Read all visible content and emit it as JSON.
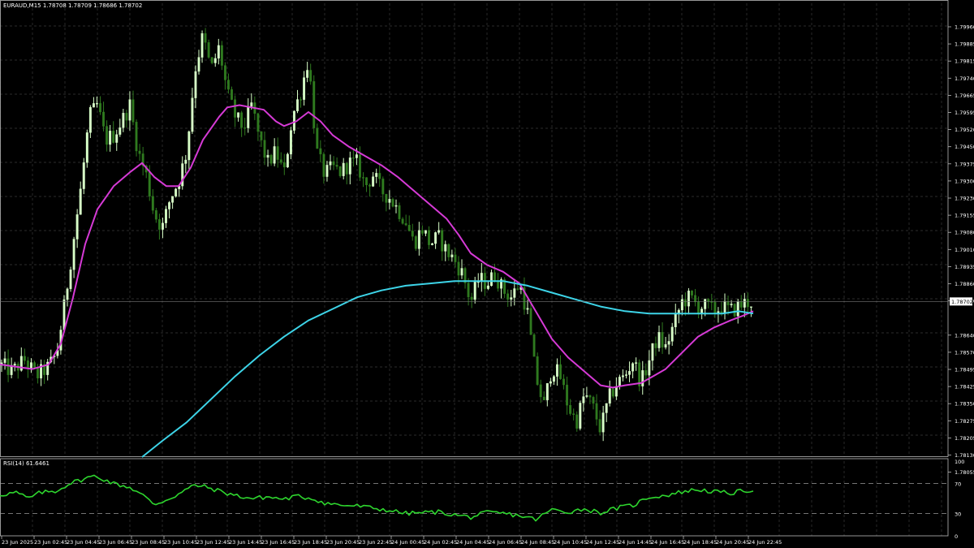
{
  "header": {
    "symbol_info": "EURAUD,M15  1.78708 1.78709 1.78686 1.78702"
  },
  "colors": {
    "background": "#000000",
    "grid": "#3a3a3a",
    "candle_bull": "#d8ffc8",
    "candle_bear": "#2f7a1f",
    "ma_fast": "#d63ad6",
    "ma_slow": "#3dd4e8",
    "rsi_line": "#2ed62e",
    "price_tag_bg": "#ffffff",
    "price_tag_text": "#000000"
  },
  "chart_data": [
    {
      "type": "candlestick",
      "title": "EURAUD,M15",
      "price_axis_ticks": [
        "1.79960",
        "1.79885",
        "1.79815",
        "1.79740",
        "1.79665",
        "1.79595",
        "1.79520",
        "1.79450",
        "1.79375",
        "1.79300",
        "1.79230",
        "1.79155",
        "1.79080",
        "1.79010",
        "1.78935",
        "1.78860",
        "1.78790",
        "1.78640",
        "1.78570",
        "1.78495",
        "1.78425",
        "1.78350",
        "1.78275",
        "1.78205",
        "1.78130",
        "1.78055"
      ],
      "ylim": [
        1.7803,
        1.7999
      ],
      "current_price": "1.78702",
      "last_ohlc": {
        "open": 1.78708,
        "high": 1.78709,
        "low": 1.78686,
        "close": 1.78702
      },
      "grid": true,
      "series": [
        {
          "kind": "moving_average",
          "color": "#d63ad6",
          "points": [
            [
              0,
              1.7843
            ],
            [
              20,
              1.7842
            ],
            [
              40,
              1.7841
            ],
            [
              60,
              1.7843
            ],
            [
              75,
              1.7852
            ],
            [
              90,
              1.7872
            ],
            [
              105,
              1.7895
            ],
            [
              120,
              1.791
            ],
            [
              140,
              1.792
            ],
            [
              160,
              1.7926
            ],
            [
              175,
              1.793
            ],
            [
              190,
              1.7924
            ],
            [
              205,
              1.792
            ],
            [
              220,
              1.792
            ],
            [
              235,
              1.7928
            ],
            [
              250,
              1.794
            ],
            [
              270,
              1.795
            ],
            [
              280,
              1.7954
            ],
            [
              295,
              1.7955
            ],
            [
              310,
              1.7954
            ],
            [
              325,
              1.7953
            ],
            [
              340,
              1.7948
            ],
            [
              350,
              1.7946
            ],
            [
              365,
              1.7948
            ],
            [
              380,
              1.7952
            ],
            [
              395,
              1.7948
            ],
            [
              410,
              1.7942
            ],
            [
              430,
              1.7937
            ],
            [
              450,
              1.7933
            ],
            [
              470,
              1.7929
            ],
            [
              490,
              1.7924
            ],
            [
              510,
              1.7918
            ],
            [
              530,
              1.7912
            ],
            [
              550,
              1.7906
            ],
            [
              565,
              1.7899
            ],
            [
              580,
              1.7891
            ],
            [
              600,
              1.7886
            ],
            [
              620,
              1.7883
            ],
            [
              640,
              1.7878
            ],
            [
              660,
              1.7866
            ],
            [
              680,
              1.7854
            ],
            [
              700,
              1.7846
            ],
            [
              720,
              1.784
            ],
            [
              740,
              1.7834
            ],
            [
              755,
              1.7833
            ],
            [
              770,
              1.7834
            ],
            [
              790,
              1.7835
            ],
            [
              805,
              1.7838
            ],
            [
              820,
              1.7841
            ],
            [
              840,
              1.7848
            ],
            [
              860,
              1.7855
            ],
            [
              880,
              1.7859
            ],
            [
              900,
              1.7862
            ],
            [
              915,
              1.7864
            ],
            [
              928,
              1.7866
            ]
          ]
        },
        {
          "kind": "moving_average",
          "color": "#3dd4e8",
          "points": [
            [
              175,
              1.7803
            ],
            [
              200,
              1.781
            ],
            [
              230,
              1.7818
            ],
            [
              260,
              1.7828
            ],
            [
              290,
              1.7838
            ],
            [
              320,
              1.7847
            ],
            [
              350,
              1.7855
            ],
            [
              380,
              1.7862
            ],
            [
              410,
              1.7867
            ],
            [
              440,
              1.7872
            ],
            [
              470,
              1.7875
            ],
            [
              500,
              1.7877
            ],
            [
              530,
              1.7878
            ],
            [
              560,
              1.7879
            ],
            [
              590,
              1.7879
            ],
            [
              620,
              1.7879
            ],
            [
              650,
              1.7877
            ],
            [
              680,
              1.7874
            ],
            [
              710,
              1.7871
            ],
            [
              740,
              1.7868
            ],
            [
              770,
              1.7866
            ],
            [
              800,
              1.7865
            ],
            [
              830,
              1.7865
            ],
            [
              860,
              1.7865
            ],
            [
              890,
              1.7865
            ],
            [
              910,
              1.7866
            ],
            [
              928,
              1.7865
            ]
          ]
        }
      ],
      "price_anchors": [
        [
          0,
          1.7843
        ],
        [
          15,
          1.784
        ],
        [
          30,
          1.7845
        ],
        [
          45,
          1.7838
        ],
        [
          60,
          1.7842
        ],
        [
          70,
          1.7848
        ],
        [
          80,
          1.787
        ],
        [
          90,
          1.7895
        ],
        [
          100,
          1.792
        ],
        [
          110,
          1.795
        ],
        [
          120,
          1.7955
        ],
        [
          130,
          1.794
        ],
        [
          140,
          1.7942
        ],
        [
          150,
          1.7948
        ],
        [
          160,
          1.7955
        ],
        [
          170,
          1.7935
        ],
        [
          180,
          1.7925
        ],
        [
          190,
          1.7908
        ],
        [
          200,
          1.7902
        ],
        [
          210,
          1.7915
        ],
        [
          220,
          1.7922
        ],
        [
          230,
          1.7935
        ],
        [
          240,
          1.797
        ],
        [
          250,
          1.7985
        ],
        [
          260,
          1.797
        ],
        [
          270,
          1.798
        ],
        [
          280,
          1.796
        ],
        [
          290,
          1.795
        ],
        [
          300,
          1.7945
        ],
        [
          310,
          1.7955
        ],
        [
          320,
          1.794
        ],
        [
          330,
          1.793
        ],
        [
          340,
          1.7935
        ],
        [
          350,
          1.7925
        ],
        [
          360,
          1.795
        ],
        [
          370,
          1.796
        ],
        [
          380,
          1.7975
        ],
        [
          390,
          1.7935
        ],
        [
          400,
          1.7925
        ],
        [
          410,
          1.7928
        ],
        [
          420,
          1.7926
        ],
        [
          430,
          1.793
        ],
        [
          440,
          1.793
        ],
        [
          450,
          1.792
        ],
        [
          460,
          1.7925
        ],
        [
          470,
          1.7918
        ],
        [
          480,
          1.7915
        ],
        [
          490,
          1.791
        ],
        [
          500,
          1.7905
        ],
        [
          510,
          1.7895
        ],
        [
          520,
          1.7902
        ],
        [
          530,
          1.7895
        ],
        [
          540,
          1.7898
        ],
        [
          550,
          1.7892
        ],
        [
          560,
          1.7888
        ],
        [
          570,
          1.7882
        ],
        [
          580,
          1.787
        ],
        [
          590,
          1.788
        ],
        [
          600,
          1.7878
        ],
        [
          610,
          1.7882
        ],
        [
          620,
          1.7875
        ],
        [
          630,
          1.7872
        ],
        [
          640,
          1.7878
        ],
        [
          650,
          1.7865
        ],
        [
          660,
          1.7838
        ],
        [
          670,
          1.7825
        ],
        [
          680,
          1.7842
        ],
        [
          690,
          1.7838
        ],
        [
          700,
          1.7825
        ],
        [
          710,
          1.7818
        ],
        [
          720,
          1.783
        ],
        [
          730,
          1.7825
        ],
        [
          740,
          1.7815
        ],
        [
          750,
          1.7828
        ],
        [
          760,
          1.7835
        ],
        [
          770,
          1.7838
        ],
        [
          780,
          1.7845
        ],
        [
          790,
          1.7835
        ],
        [
          800,
          1.7845
        ],
        [
          810,
          1.7855
        ],
        [
          820,
          1.785
        ],
        [
          830,
          1.786
        ],
        [
          840,
          1.787
        ],
        [
          850,
          1.7872
        ],
        [
          860,
          1.7868
        ],
        [
          870,
          1.7868
        ],
        [
          880,
          1.7866
        ],
        [
          890,
          1.7868
        ],
        [
          900,
          1.7866
        ],
        [
          910,
          1.7868
        ],
        [
          920,
          1.787
        ],
        [
          928,
          1.787
        ]
      ]
    },
    {
      "type": "line",
      "title": "RSI(14) 61.6461",
      "ylim": [
        0,
        100
      ],
      "levels": [
        30,
        70
      ],
      "axis_ticks": [
        "100",
        "70",
        "30",
        "0"
      ],
      "x_labels": [
        "23 Jun 2025",
        "23 Jun 02:45",
        "23 Jun 04:45",
        "23 Jun 06:45",
        "23 Jun 08:45",
        "23 Jun 10:45",
        "23 Jun 12:45",
        "23 Jun 14:45",
        "23 Jun 16:45",
        "23 Jun 18:45",
        "23 Jun 20:45",
        "23 Jun 22:45",
        "24 Jun 00:45",
        "24 Jun 02:45",
        "24 Jun 04:45",
        "24 Jun 06:45",
        "24 Jun 08:45",
        "24 Jun 10:45",
        "24 Jun 12:45",
        "24 Jun 14:45",
        "24 Jun 16:45",
        "24 Jun 18:45",
        "24 Jun 20:45",
        "24 Jun 22:45"
      ],
      "series": [
        {
          "color": "#2ed62e",
          "points": [
            [
              0,
              55
            ],
            [
              20,
              58
            ],
            [
              35,
              50
            ],
            [
              50,
              58
            ],
            [
              70,
              60
            ],
            [
              85,
              70
            ],
            [
              100,
              75
            ],
            [
              115,
              80
            ],
            [
              125,
              77
            ],
            [
              140,
              70
            ],
            [
              160,
              65
            ],
            [
              175,
              55
            ],
            [
              190,
              42
            ],
            [
              205,
              48
            ],
            [
              220,
              56
            ],
            [
              240,
              68
            ],
            [
              255,
              65
            ],
            [
              270,
              60
            ],
            [
              290,
              54
            ],
            [
              310,
              50
            ],
            [
              330,
              52
            ],
            [
              350,
              49
            ],
            [
              365,
              53
            ],
            [
              385,
              50
            ],
            [
              400,
              44
            ],
            [
              420,
              41
            ],
            [
              440,
              40
            ],
            [
              460,
              37
            ],
            [
              480,
              34
            ],
            [
              500,
              30
            ],
            [
              520,
              31
            ],
            [
              540,
              32
            ],
            [
              560,
              28
            ],
            [
              580,
              25
            ],
            [
              600,
              31
            ],
            [
              620,
              30
            ],
            [
              640,
              27
            ],
            [
              660,
              22
            ],
            [
              680,
              35
            ],
            [
              700,
              32
            ],
            [
              720,
              36
            ],
            [
              740,
              31
            ],
            [
              760,
              37
            ],
            [
              780,
              41
            ],
            [
              800,
              52
            ],
            [
              820,
              54
            ],
            [
              840,
              59
            ],
            [
              860,
              62
            ],
            [
              880,
              59
            ],
            [
              900,
              57
            ],
            [
              915,
              60
            ],
            [
              928,
              61.6
            ]
          ]
        }
      ]
    }
  ]
}
